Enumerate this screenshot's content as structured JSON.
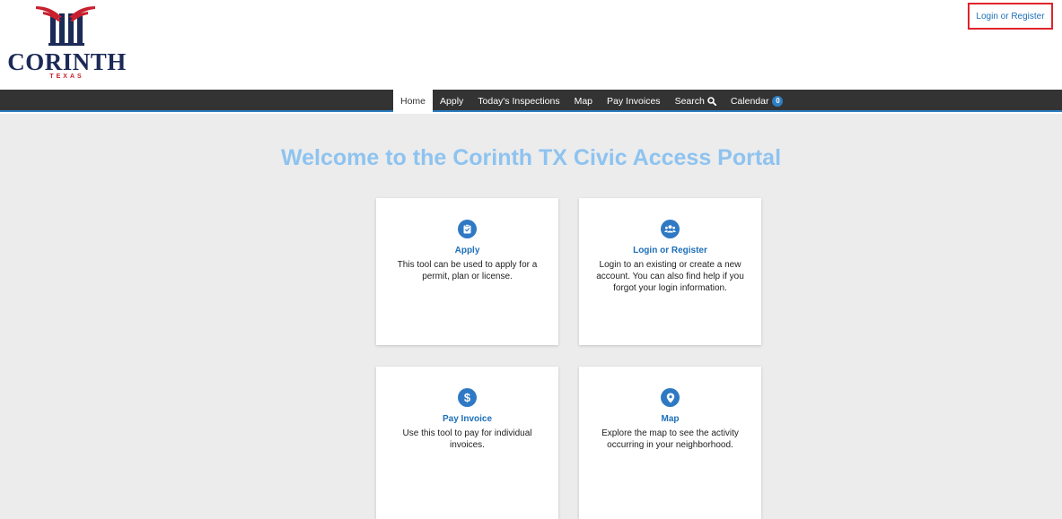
{
  "header": {
    "logo": {
      "name": "CORINTH",
      "sub": "TEXAS",
      "colors": {
        "navy": "#1b2a57",
        "red": "#c8202e"
      }
    },
    "login_label": "Login or Register"
  },
  "nav": {
    "items": [
      {
        "label": "Home",
        "active": true
      },
      {
        "label": "Apply"
      },
      {
        "label": "Today's Inspections"
      },
      {
        "label": "Map"
      },
      {
        "label": "Pay Invoices"
      },
      {
        "label": "Search",
        "icon": "search-icon"
      },
      {
        "label": "Calendar",
        "badge": "0"
      }
    ]
  },
  "main": {
    "title": "Welcome to the Corinth TX Civic Access Portal",
    "cards": [
      {
        "icon": "clipboard-check-icon",
        "title": "Apply",
        "desc": "This tool can be used to apply for a permit, plan or license."
      },
      {
        "icon": "users-icon",
        "title": "Login or Register",
        "desc": "Login to an existing or create a new account. You can also find help if you forgot your login information."
      },
      {
        "icon": "dollar-icon",
        "title": "Pay Invoice",
        "desc": "Use this tool to pay for individual invoices."
      },
      {
        "icon": "map-pin-icon",
        "title": "Map",
        "desc": "Explore the map to see the activity occurring in your neighborhood."
      }
    ]
  },
  "colors": {
    "accent": "#2c7fc2",
    "nav_bg": "#333333",
    "title": "#8ec3f0",
    "highlight_border": "#e0242b"
  }
}
